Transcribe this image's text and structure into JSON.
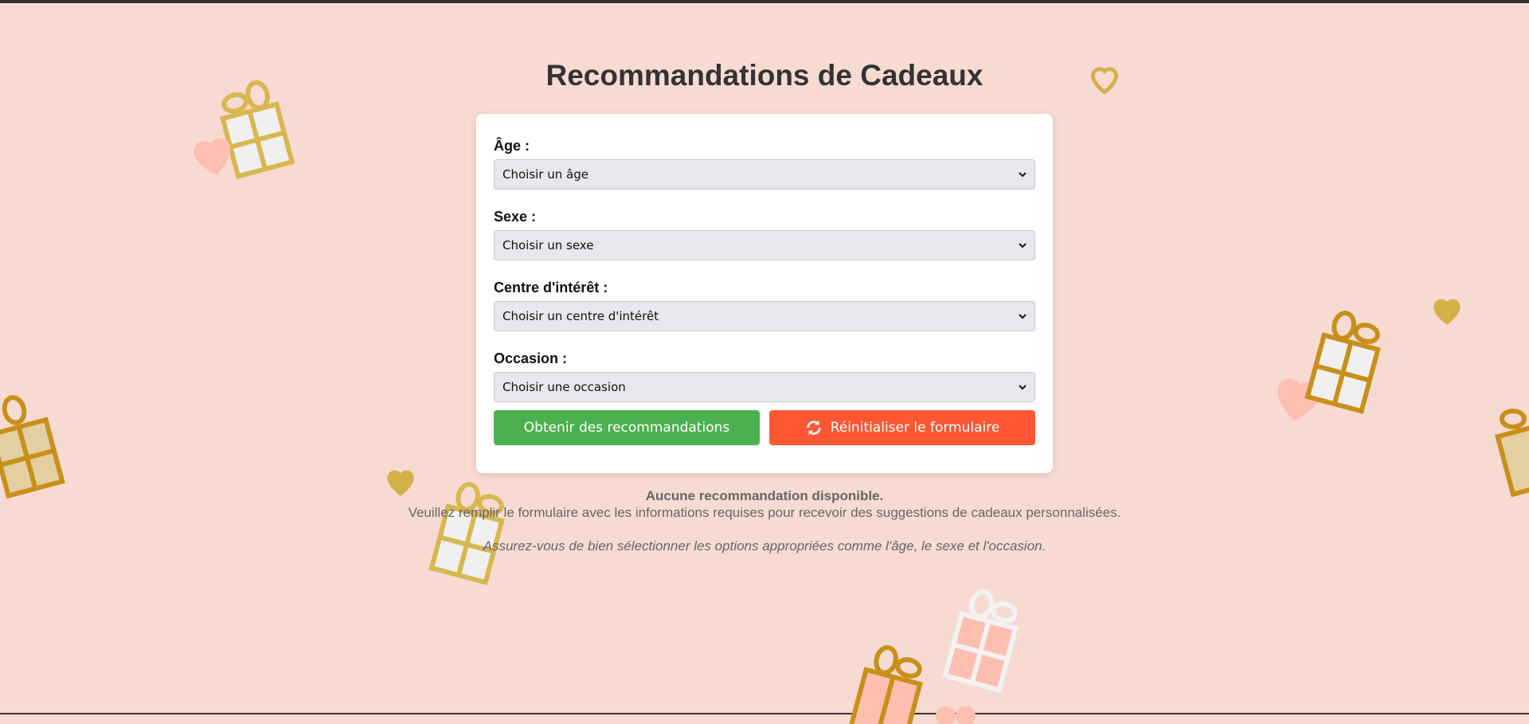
{
  "page": {
    "title": "Recommandations de Cadeaux"
  },
  "form": {
    "age": {
      "label": "Âge :",
      "selected": "Choisir un âge"
    },
    "sex": {
      "label": "Sexe :",
      "selected": "Choisir un sexe"
    },
    "interest": {
      "label": "Centre d'intérêt :",
      "selected": "Choisir un centre d'intérêt"
    },
    "occasion": {
      "label": "Occasion :",
      "selected": "Choisir une occasion"
    },
    "submit_label": "Obtenir des recommandations",
    "reset_label": "Réinitialiser le formulaire"
  },
  "empty_state": {
    "title": "Aucune recommandation disponible.",
    "body": "Veuillez remplir le formulaire avec les informations requises pour recevoir des suggestions de cadeaux personnalisées.",
    "hint": "Assurez-vous de bien sélectionner les options appropriées comme l'âge, le sexe et l'occasion."
  },
  "colors": {
    "background": "#f7dbd3",
    "submit": "#4caf50",
    "reset": "#ff5733",
    "gold": "#d4b04a",
    "pink": "#ffbfb0"
  },
  "icons": {
    "reset": "refresh-icon",
    "decor": [
      "gift-icon",
      "heart-icon"
    ]
  }
}
